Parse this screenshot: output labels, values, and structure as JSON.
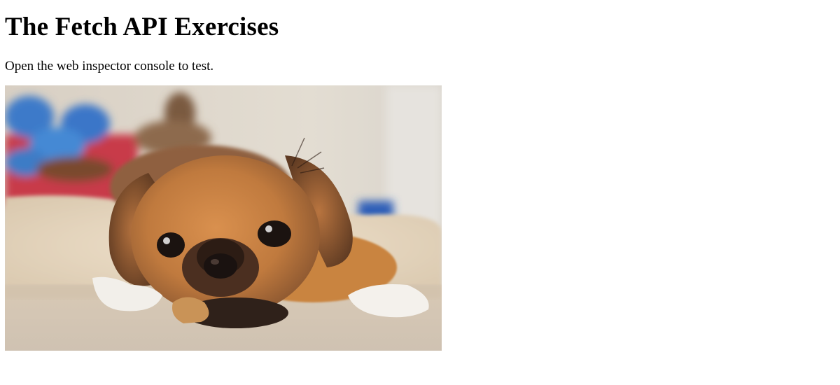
{
  "page": {
    "heading": "The Fetch API Exercises",
    "instructions": "Open the web inspector console to test.",
    "image": {
      "alt": "Puppy lying on a rug chewing a treat",
      "subject": "puppy-photo"
    }
  }
}
